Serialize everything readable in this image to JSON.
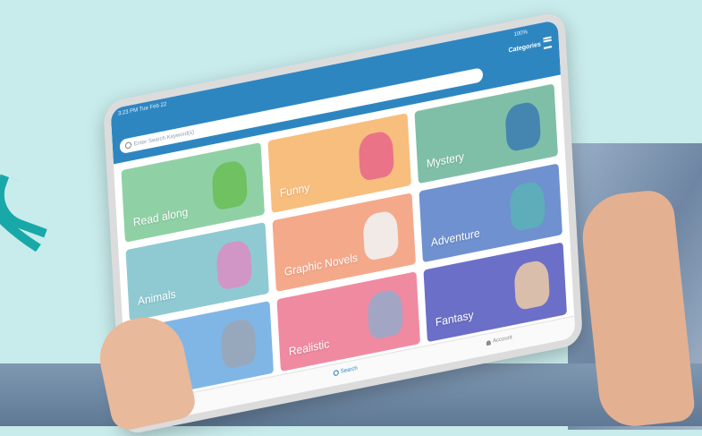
{
  "statusbar": {
    "time": "3:23 PM  Tue Feb 22",
    "battery": "100%"
  },
  "header": {
    "categories_label": "Categories"
  },
  "search": {
    "placeholder": "Enter Search Keyword(s)"
  },
  "tiles": [
    {
      "label": "Read along",
      "bg": "#8fd1a5",
      "art": "#6bbf5a"
    },
    {
      "label": "Funny",
      "bg": "#f7be7d",
      "art": "#e86a8a"
    },
    {
      "label": "Mystery",
      "bg": "#7fbfa8",
      "art": "#3f7fb0"
    },
    {
      "label": "Animals",
      "bg": "#8fcad3",
      "art": "#d88fc4"
    },
    {
      "label": "Graphic Novels",
      "bg": "#f5a98b",
      "art": "#f1f1f1"
    },
    {
      "label": "Adventure",
      "bg": "#6f91cf",
      "art": "#5bb0b8"
    },
    {
      "label": "",
      "bg": "#7fb6e6",
      "art": "#9aa6b8"
    },
    {
      "label": "Realistic",
      "bg": "#f08aa1",
      "art": "#9aa7c9"
    },
    {
      "label": "Fantasy",
      "bg": "#6b6fc7",
      "art": "#e7c6a8"
    }
  ],
  "tabbar": {
    "search_label": "Search",
    "account_label": "Account"
  },
  "colors": {
    "accent": "#2e86c1",
    "cloud": "#18a8a8",
    "background": "#c8ebeb"
  },
  "icons": {
    "search": "search-icon",
    "categories": "list-icon",
    "account": "person-icon"
  }
}
